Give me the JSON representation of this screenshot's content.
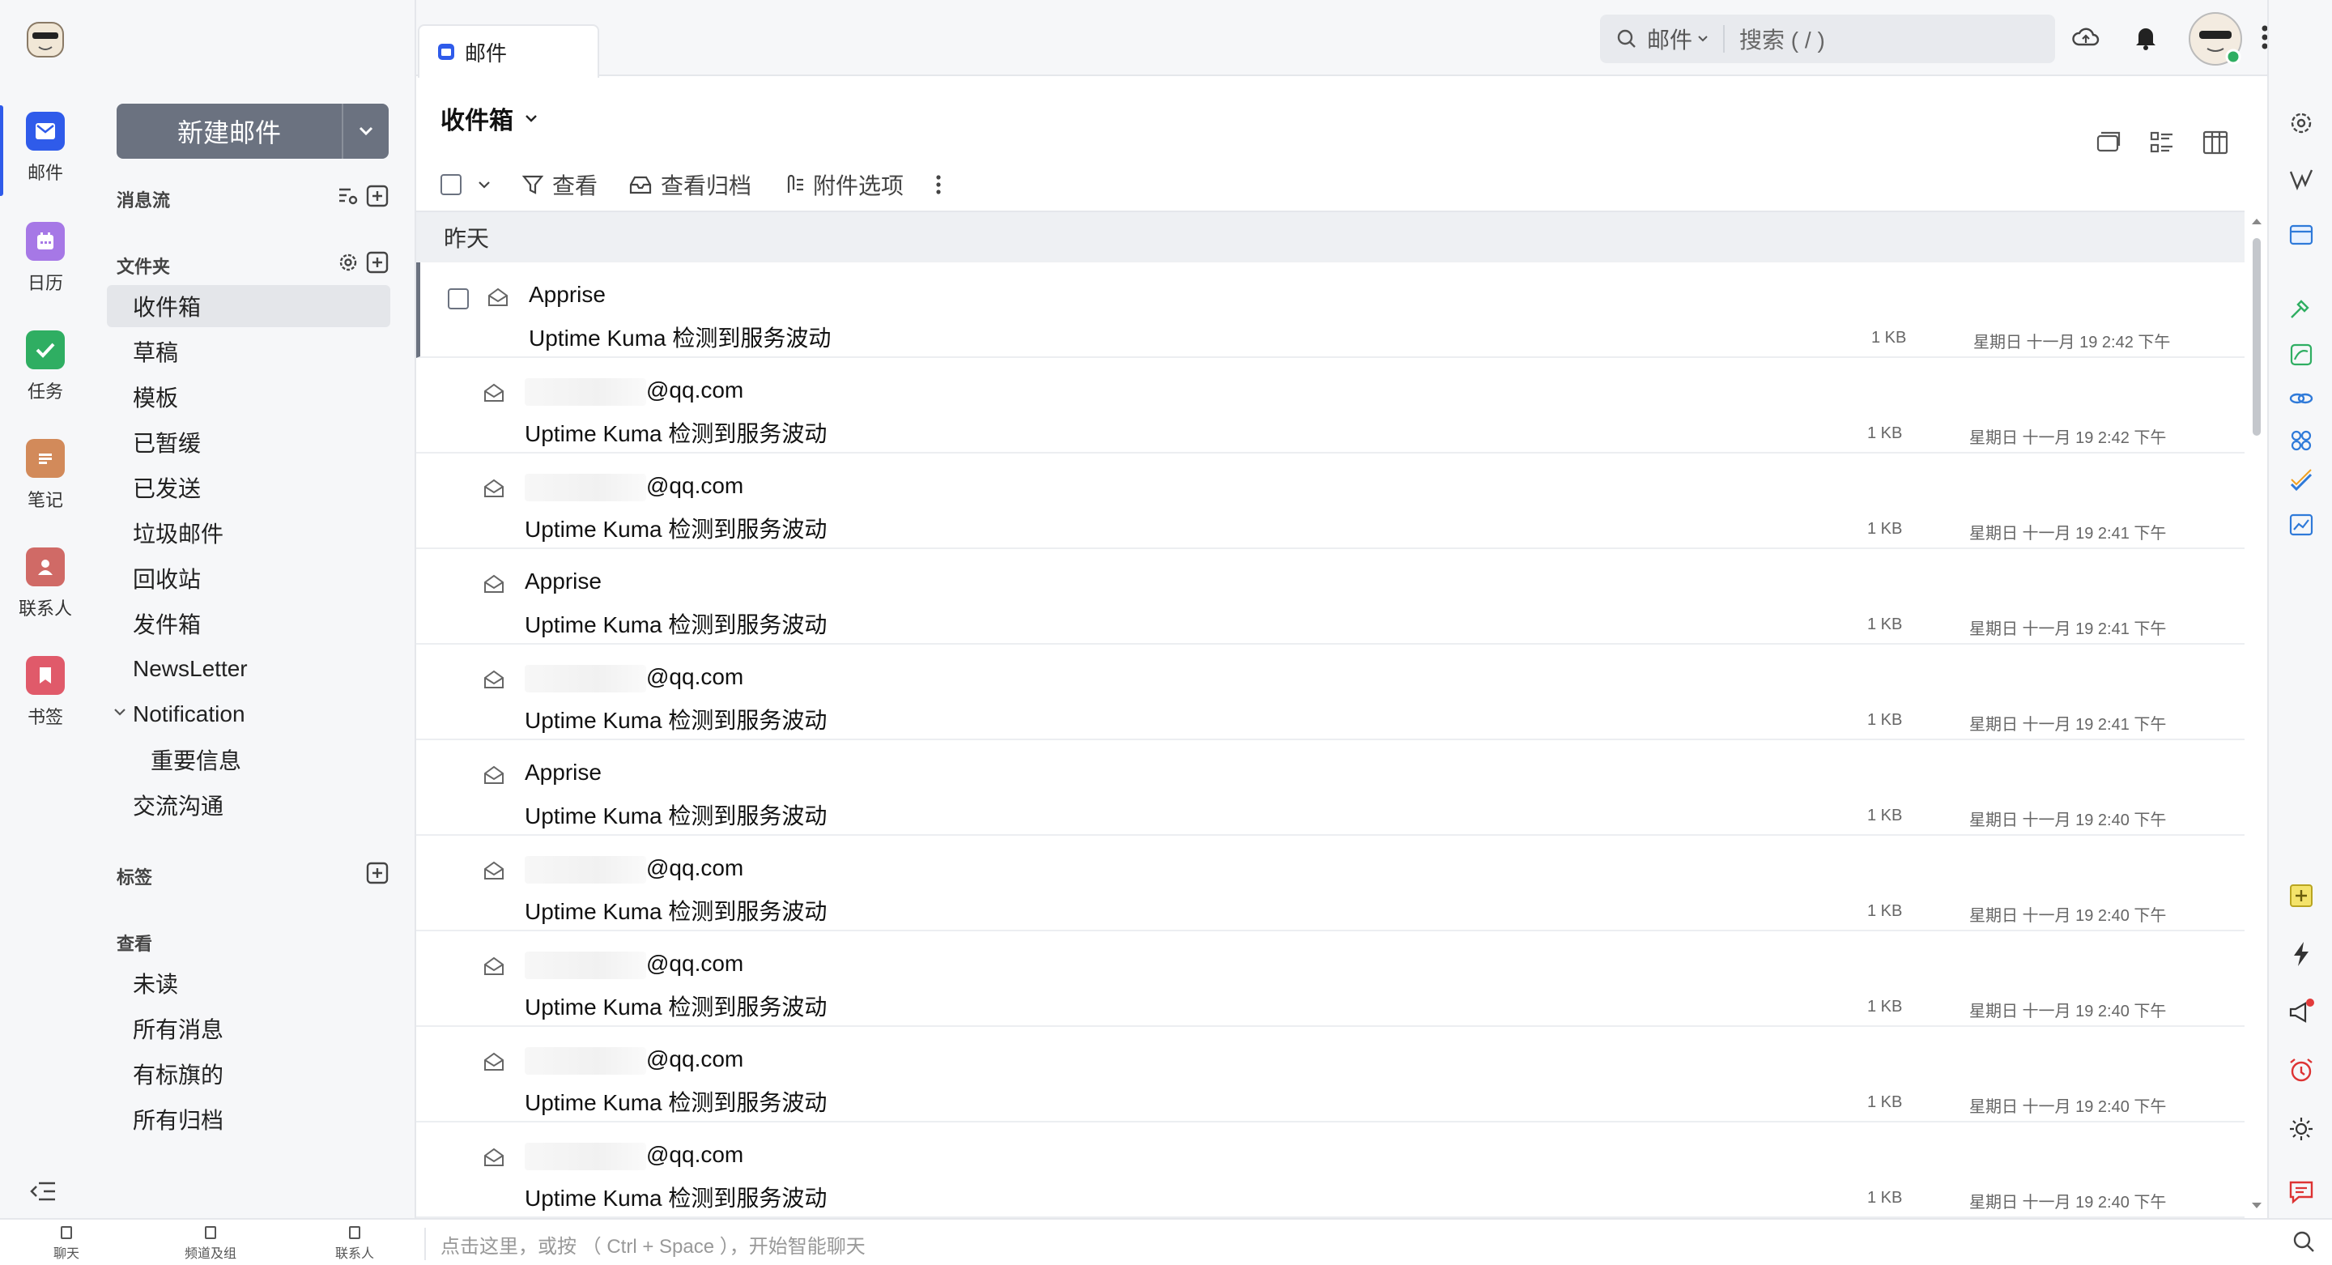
{
  "rail": {
    "items": [
      {
        "label": "邮件",
        "icon": "mail-icon",
        "color": "#2f5bea"
      },
      {
        "label": "日历",
        "icon": "calendar-icon",
        "color": "#a678e6"
      },
      {
        "label": "任务",
        "icon": "task-icon",
        "color": "#2fae62"
      },
      {
        "label": "笔记",
        "icon": "note-icon",
        "color": "#d28a5a"
      },
      {
        "label": "联系人",
        "icon": "contact-icon",
        "color": "#d06a66"
      },
      {
        "label": "书签",
        "icon": "bookmark-icon",
        "color": "#e05a6a"
      }
    ]
  },
  "compose": {
    "label": "新建邮件"
  },
  "sections": {
    "stream": "消息流",
    "folders": "文件夹",
    "tags": "标签",
    "views": "查看"
  },
  "folders": [
    {
      "label": "收件箱"
    },
    {
      "label": "草稿"
    },
    {
      "label": "模板"
    },
    {
      "label": "已暂缓"
    },
    {
      "label": "已发送"
    },
    {
      "label": "垃圾邮件"
    },
    {
      "label": "回收站"
    },
    {
      "label": "发件箱"
    },
    {
      "label": "NewsLetter"
    },
    {
      "label": "Notification"
    },
    {
      "label": "重要信息"
    },
    {
      "label": "交流沟通"
    }
  ],
  "views": [
    {
      "label": "未读"
    },
    {
      "label": "所有消息"
    },
    {
      "label": "有标旗的"
    },
    {
      "label": "所有归档"
    }
  ],
  "tab": {
    "label": "邮件"
  },
  "search": {
    "scope": "邮件",
    "placeholder": "搜索 ( / )"
  },
  "mailbox": {
    "title": "收件箱"
  },
  "toolbar": {
    "view": "查看",
    "archive": "查看归档",
    "attach": "附件选项"
  },
  "list": {
    "group": "昨天",
    "rows": [
      {
        "from": "Apprise",
        "subject": "Uptime Kuma 检测到服务波动",
        "size": "1 KB",
        "date": "星期日 十一月 19 2:42 下午"
      },
      {
        "from": "@qq.com",
        "subject": "Uptime Kuma 检测到服务波动",
        "size": "1 KB",
        "date": "星期日 十一月 19 2:42 下午"
      },
      {
        "from": "@qq.com",
        "subject": "Uptime Kuma 检测到服务波动",
        "size": "1 KB",
        "date": "星期日 十一月 19 2:41 下午"
      },
      {
        "from": "Apprise",
        "subject": "Uptime Kuma 检测到服务波动",
        "size": "1 KB",
        "date": "星期日 十一月 19 2:41 下午"
      },
      {
        "from": "@qq.com",
        "subject": "Uptime Kuma 检测到服务波动",
        "size": "1 KB",
        "date": "星期日 十一月 19 2:41 下午"
      },
      {
        "from": "Apprise",
        "subject": "Uptime Kuma 检测到服务波动",
        "size": "1 KB",
        "date": "星期日 十一月 19 2:40 下午"
      },
      {
        "from": "@qq.com",
        "subject": "Uptime Kuma 检测到服务波动",
        "size": "1 KB",
        "date": "星期日 十一月 19 2:40 下午"
      },
      {
        "from": "@qq.com",
        "subject": "Uptime Kuma 检测到服务波动",
        "size": "1 KB",
        "date": "星期日 十一月 19 2:40 下午"
      },
      {
        "from": "@qq.com",
        "subject": "Uptime Kuma 检测到服务波动",
        "size": "1 KB",
        "date": "星期日 十一月 19 2:40 下午"
      },
      {
        "from": "@qq.com",
        "subject": "Uptime Kuma 检测到服务波动",
        "size": "1 KB",
        "date": "星期日 十一月 19 2:40 下午"
      }
    ]
  },
  "bottom": {
    "items": [
      {
        "label": "聊天"
      },
      {
        "label": "频道及组"
      },
      {
        "label": "联系人"
      }
    ],
    "chat_placeholder": "点击这里，或按 （ Ctrl + Space ），开始智能聊天"
  },
  "colors": {
    "accent": "#2f5bea",
    "compose": "#6b7280",
    "online": "#2fae62",
    "alert": "#e23b3b"
  }
}
